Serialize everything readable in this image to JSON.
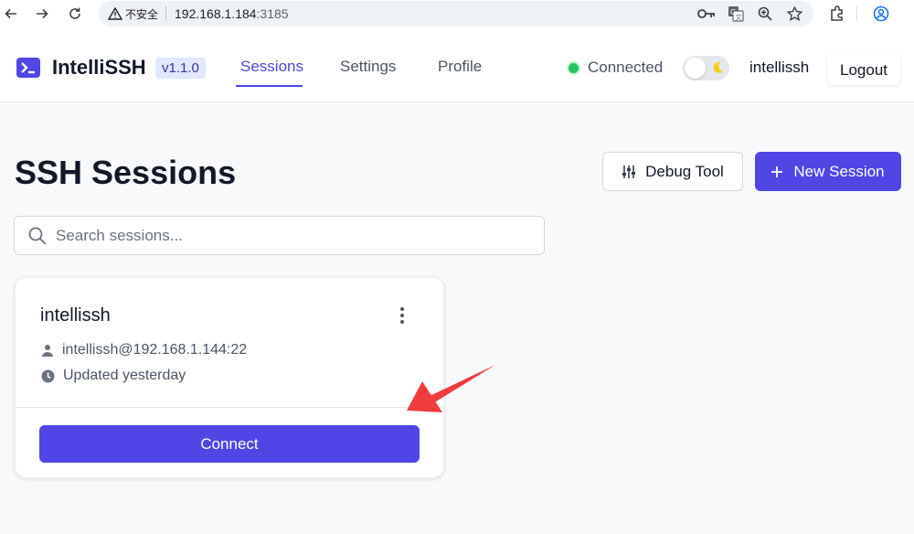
{
  "browser": {
    "security_label": "不安全",
    "url_host": "192.168.1.184",
    "url_port": ":3185"
  },
  "header": {
    "brand": "IntelliSSH",
    "version": "v1.1.0",
    "nav": [
      {
        "label": "Sessions",
        "active": true
      },
      {
        "label": "Settings",
        "active": false
      },
      {
        "label": "Profile",
        "active": false
      }
    ],
    "status": "Connected",
    "status_color": "#22c55e",
    "theme_toggle": "dark-mode-off",
    "username": "intellissh",
    "logout_label": "Logout"
  },
  "page": {
    "title": "SSH Sessions",
    "debug_label": "Debug Tool",
    "new_session_label": "New Session",
    "search_placeholder": "Search sessions...",
    "accent_color": "#4f46e5"
  },
  "sessions": [
    {
      "name": "intellissh",
      "connection": "intellissh@192.168.1.144:22",
      "updated": "Updated yesterday",
      "connect_label": "Connect"
    }
  ],
  "annotation": {
    "type": "red-arrow",
    "color": "#f03c3c"
  }
}
